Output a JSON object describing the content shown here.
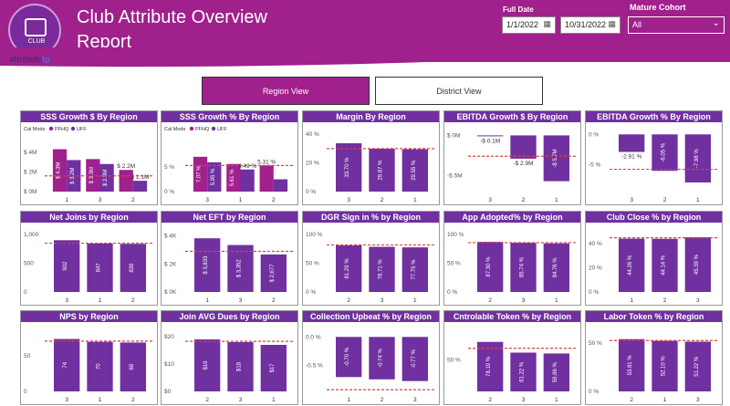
{
  "header": {
    "title": "Club Attribute Overview Report",
    "logo_word_a": "attribute",
    "logo_word_b": "tp",
    "logo_text": "CLUB"
  },
  "filters": {
    "full_date_label": "Full Date",
    "start_date": "1/1/2022",
    "end_date": "10/31/2022",
    "cohort_label": "Mature Cohort",
    "cohort_value": "All",
    "calendar_icon": "calendar-icon",
    "chevron_icon": "chevron-down-icon"
  },
  "views": {
    "region": "Region View",
    "district": "District View"
  },
  "colors": {
    "header": "#a0208c",
    "bar_purple": "#7030a0",
    "bar_magenta": "#a0208c",
    "target_line": "#e04040"
  },
  "panels": [
    {
      "id": "sss-growth-dollar",
      "title": "SSS Growth $ By Region",
      "legend": {
        "label": "Cal Mode",
        "items": [
          "PFHQ",
          "UFF"
        ]
      },
      "chart_data": {
        "type": "bar",
        "categories": [
          "1",
          "3",
          "2"
        ],
        "series": [
          {
            "name": "PFHQ",
            "values": [
              4.3,
              3.3,
              2.2
            ]
          },
          {
            "name": "UFF",
            "values": [
              3.2,
              2.8,
              1.1
            ]
          }
        ],
        "labels": [
          [
            "$ 4.3M",
            "$ 3.3M",
            "$ 2.2M"
          ],
          [
            "$ 3.2M",
            "$ 2.8M",
            "$ 1.1M"
          ]
        ],
        "ticks": [
          "$ 0M",
          "$ 2M",
          "$ 4M"
        ],
        "ylim": [
          0,
          5
        ],
        "target": 1.6
      }
    },
    {
      "id": "sss-growth-pct",
      "title": "SSS Growth % By Region",
      "legend": {
        "label": "Cal Mode",
        "items": [
          "PFHQ",
          "UFF"
        ]
      },
      "chart_data": {
        "type": "bar",
        "categories": [
          "3",
          "1",
          "2"
        ],
        "series": [
          {
            "name": "PFHQ",
            "values": [
              7.07,
              5.61,
              5.31
            ]
          },
          {
            "name": "UFF",
            "values": [
              5.95,
              4.49,
              2.5
            ]
          }
        ],
        "labels": [
          [
            "7.07 %",
            "5.61 %",
            "5.31 %"
          ],
          [
            "5.95 %",
            "4.49 %",
            ""
          ]
        ],
        "ticks": [
          "0 %",
          "5 %"
        ],
        "ylim": [
          0,
          10
        ],
        "target": 5.3
      }
    },
    {
      "id": "margin",
      "title": "Margin By Region",
      "chart_data": {
        "type": "bar",
        "categories": [
          "3",
          "2",
          "1"
        ],
        "series": [
          {
            "values": [
              33.7,
              29.87,
              29.55
            ]
          }
        ],
        "labels": [
          [
            "33.70 %",
            "29.87 %",
            "29.55 %"
          ]
        ],
        "ticks": [
          "0 %",
          "20 %",
          "40 %"
        ],
        "ylim": [
          0,
          42
        ],
        "target": 30
      }
    },
    {
      "id": "ebitda-growth-dollar",
      "title": "EBITDA Growth $ By Region",
      "chart_data": {
        "type": "bar",
        "categories": [
          "3",
          "2",
          "1"
        ],
        "series": [
          {
            "values": [
              -0.1,
              -2.9,
              -5.7
            ]
          }
        ],
        "labels": [
          [
            "-$ 0.1M",
            "-$ 2.9M",
            "-$ 5.7M"
          ]
        ],
        "ticks": [
          "-$ 5M",
          "$ 0M"
        ],
        "ylim": [
          -7,
          0.5
        ],
        "target": -2.6
      }
    },
    {
      "id": "ebitda-growth-pct",
      "title": "EBITDA Growth %  By Region",
      "chart_data": {
        "type": "bar",
        "categories": [
          "3",
          "2",
          "1"
        ],
        "series": [
          {
            "values": [
              -2.91,
              -6.05,
              -7.98
            ]
          }
        ],
        "labels": [
          [
            "-2.91 %",
            "-6.05 %",
            "-7.98 %"
          ]
        ],
        "ticks": [
          "-5 %",
          "0 %"
        ],
        "ylim": [
          -9.5,
          0.5
        ],
        "target": -5.8
      }
    },
    {
      "id": "net-joins",
      "title": "Net Joins by Region",
      "chart_data": {
        "type": "bar",
        "categories": [
          "3",
          "1",
          "2"
        ],
        "series": [
          {
            "values": [
              902,
              847,
              839
            ]
          }
        ],
        "labels": [
          [
            "902",
            "847",
            "839"
          ]
        ],
        "ticks": [
          "0",
          "500",
          "1,000"
        ],
        "ylim": [
          0,
          1050
        ],
        "target": 850
      }
    },
    {
      "id": "net-eft",
      "title": "Net EFT by Region",
      "chart_data": {
        "type": "bar",
        "categories": [
          "1",
          "3",
          "2"
        ],
        "series": [
          {
            "values": [
              3833,
              3352,
              2677
            ]
          }
        ],
        "labels": [
          [
            "$ 3,833",
            "$ 3,352",
            "$ 2,677"
          ]
        ],
        "ticks": [
          "$ 0K",
          "$ 2K",
          "$ 4K"
        ],
        "ylim": [
          0,
          4300
        ],
        "target": 2900
      }
    },
    {
      "id": "dgr-sign-in",
      "title": "DGR Sign in % by Region",
      "chart_data": {
        "type": "bar",
        "categories": [
          "2",
          "3",
          "1"
        ],
        "series": [
          {
            "values": [
              81.29,
              78.71,
              77.75
            ]
          }
        ],
        "labels": [
          [
            "81.29 %",
            "78.71 %",
            "77.75 %"
          ]
        ],
        "ticks": [
          "0 %",
          "50 %",
          "100 %"
        ],
        "ylim": [
          0,
          105
        ],
        "target": 82
      }
    },
    {
      "id": "app-adopted",
      "title": "App Adopted% by Region",
      "chart_data": {
        "type": "bar",
        "categories": [
          "2",
          "3",
          "1"
        ],
        "series": [
          {
            "values": [
              87.3,
              85.74,
              84.76
            ]
          }
        ],
        "labels": [
          [
            "87.30 %",
            "85.74 %",
            "84.76 %"
          ]
        ],
        "ticks": [
          "0 %",
          "50 %",
          "100 %"
        ],
        "ylim": [
          0,
          105
        ],
        "target": 86
      }
    },
    {
      "id": "club-close",
      "title": "Club Close % by Region",
      "chart_data": {
        "type": "bar",
        "categories": [
          "1",
          "2",
          "3"
        ],
        "series": [
          {
            "values": [
              44.26,
              44.14,
              45.39
            ]
          }
        ],
        "labels": [
          [
            "44.26 %",
            "44.14 %",
            "45.39 %"
          ]
        ],
        "ticks": [
          "0 %",
          "20 %",
          "40 %"
        ],
        "ylim": [
          0,
          50
        ],
        "target": 45
      }
    },
    {
      "id": "nps",
      "title": "NPS by Region",
      "chart_data": {
        "type": "bar",
        "categories": [
          "3",
          "1",
          "2"
        ],
        "series": [
          {
            "values": [
              74,
              70,
              69
            ]
          }
        ],
        "labels": [
          [
            "74",
            "70",
            "69"
          ]
        ],
        "ticks": [
          "0",
          "50"
        ],
        "ylim": [
          0,
          85
        ],
        "target": 71
      }
    },
    {
      "id": "join-avg-dues",
      "title": "Join AVG Dues by Region",
      "chart_data": {
        "type": "bar",
        "categories": [
          "2",
          "3",
          "1"
        ],
        "series": [
          {
            "values": [
              19,
              18,
              17
            ]
          }
        ],
        "labels": [
          [
            "$19",
            "$18",
            "$17"
          ]
        ],
        "ticks": [
          "$0",
          "$10",
          "$20"
        ],
        "ylim": [
          0,
          22
        ],
        "target": 18.3
      }
    },
    {
      "id": "collection-upbeat",
      "title": "Collection Upbeat % by Region",
      "chart_data": {
        "type": "bar",
        "categories": [
          "1",
          "2",
          "3"
        ],
        "series": [
          {
            "values": [
              -0.7,
              -0.74,
              -0.77
            ]
          }
        ],
        "labels": [
          [
            "-0.70 %",
            "-0.74 %",
            "-0.77 %"
          ]
        ],
        "ticks": [
          "-0.5 %",
          "0.0 %"
        ],
        "ylim": [
          -0.95,
          0.1
        ],
        "target": -0.92
      }
    },
    {
      "id": "controlable-token",
      "title": "Cntrolable Token % by Region",
      "chart_data": {
        "type": "bar",
        "categories": [
          "2",
          "3",
          "1"
        ],
        "series": [
          {
            "values": [
              78.1,
              61.22,
              59.86
            ]
          }
        ],
        "labels": [
          [
            "78.10 %",
            "61.22 %",
            "59.86 %"
          ]
        ],
        "ticks": [
          "50 %"
        ],
        "ylim": [
          0,
          95
        ],
        "target": 68
      }
    },
    {
      "id": "labor-token",
      "title": "Labor Token % by Region",
      "chart_data": {
        "type": "bar",
        "categories": [
          "2",
          "1",
          "3"
        ],
        "series": [
          {
            "values": [
              53.81,
              52.1,
              51.22
            ]
          }
        ],
        "labels": [
          [
            "53.81 %",
            "52.10 %",
            "51.22 %"
          ]
        ],
        "ticks": [
          "0 %",
          "50 %"
        ],
        "ylim": [
          0,
          62
        ],
        "target": 52.4
      }
    }
  ]
}
